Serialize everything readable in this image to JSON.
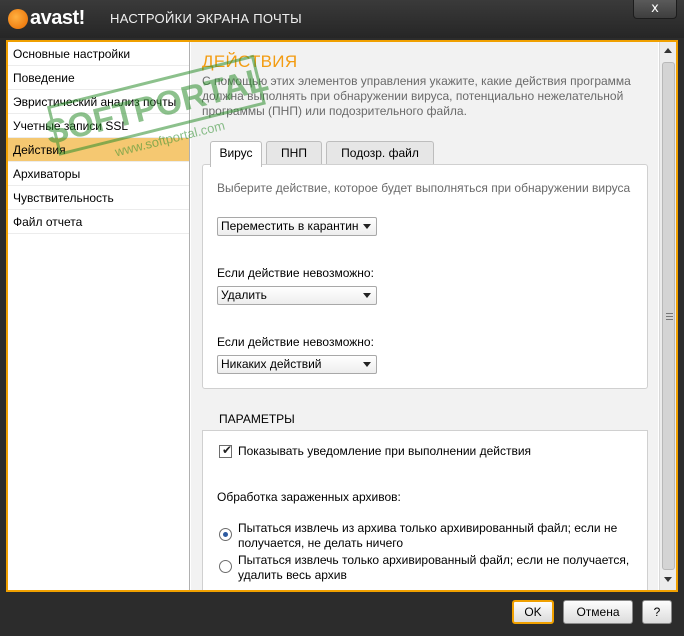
{
  "window": {
    "brand": "avast!",
    "title": "НАСТРОЙКИ ЭКРАНА ПОЧТЫ",
    "close_glyph": "x"
  },
  "sidebar": {
    "items": [
      {
        "label": "Основные настройки"
      },
      {
        "label": "Поведение"
      },
      {
        "label": "Эвристический анализ почты"
      },
      {
        "label": "Учетные записи SSL"
      },
      {
        "label": "Действия"
      },
      {
        "label": "Архиваторы"
      },
      {
        "label": "Чувствительность"
      },
      {
        "label": "Файл отчета"
      }
    ],
    "active_index": 4
  },
  "main": {
    "heading": "ДЕЙСТВИЯ",
    "description": "С помощью этих элементов управления укажите, какие действия программа должна выполнять при обнаружении вируса, потенциально нежелательной программы (ПНП) или подозрительного файла.",
    "tabs": [
      {
        "label": "Вирус",
        "active": true
      },
      {
        "label": "ПНП",
        "active": false
      },
      {
        "label": "Подозр. файл",
        "active": false
      }
    ],
    "panel": {
      "hint": "Выберите действие, которое будет выполняться при обнаружении вируса",
      "primary_action": "Переместить в карантин",
      "fallback1_label": "Если действие невозможно:",
      "fallback1_value": "Удалить",
      "fallback2_label": "Если действие невозможно:",
      "fallback2_value": "Никаких действий"
    },
    "params": {
      "title": "ПАРАМЕТРЫ",
      "notify_label": "Показывать уведомление при выполнении действия",
      "notify_checked": true,
      "archives_label": "Обработка зараженных архивов:",
      "radio1": "Пытаться извлечь из архива только архивированный файл; если не получается, не делать ничего",
      "radio1_line1": "Пытаться извлечь из архива только архивированный файл; если не",
      "radio1_line2": "получается, не делать ничего",
      "radio2_line1": "Пытаться извлечь только архивированный файл; если не получается,",
      "radio2_line2": "удалить весь архив",
      "selected_radio": 1
    }
  },
  "footer": {
    "ok": "OK",
    "cancel": "Отмена",
    "help": "?"
  },
  "watermark": {
    "brand": "SOFTPORTAL",
    "url": "www.softportal.com"
  },
  "colors": {
    "accent": "#f0a000",
    "heading": "#f39c12",
    "active_nav": "#f5c871",
    "titlebar": "#2c2c2c"
  }
}
